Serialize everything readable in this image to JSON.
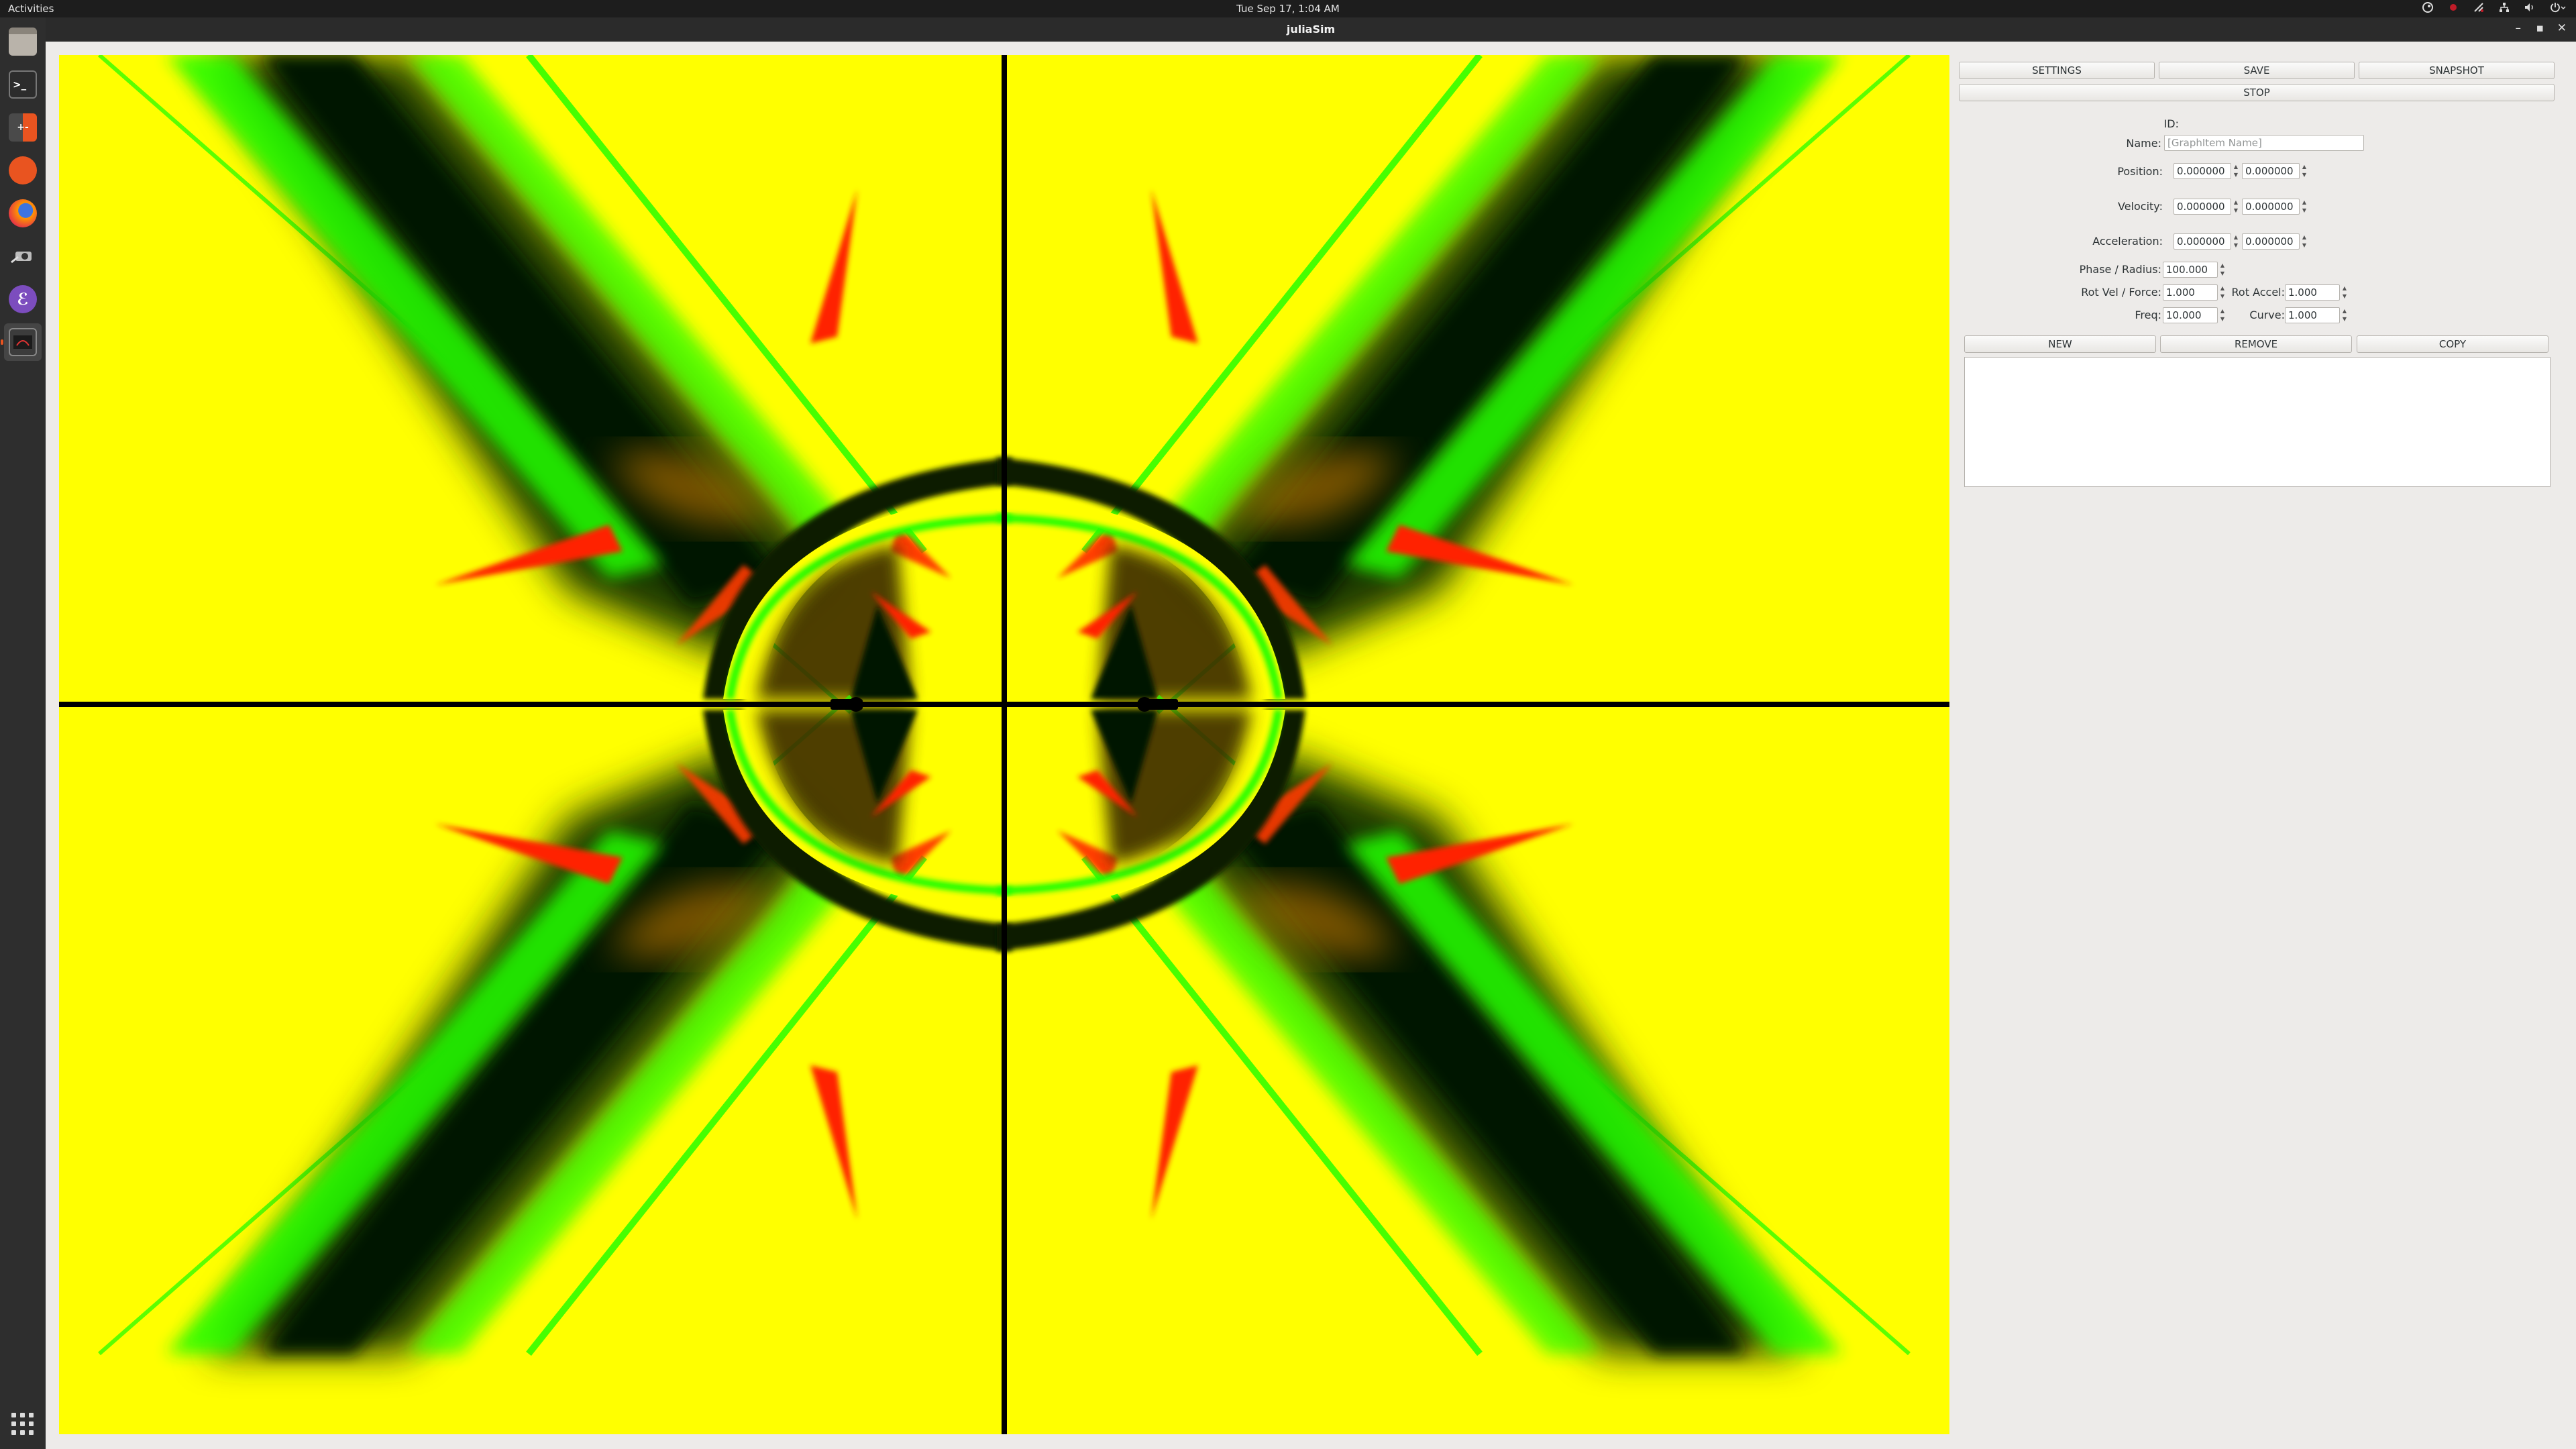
{
  "topbar": {
    "activities": "Activities",
    "clock": "Tue Sep 17,  1:04 AM",
    "tray": [
      "steam-icon",
      "record-icon",
      "antenna-icon",
      "network-icon",
      "volume-icon",
      "power-icon"
    ]
  },
  "dock": {
    "items": [
      "files-icon",
      "terminal-icon",
      "calculator-icon",
      "ubuntu-software-icon",
      "firefox-icon",
      "screenshot-tool-icon",
      "emacs-icon",
      "juliasim-app-icon"
    ]
  },
  "window": {
    "title": "juliaSim",
    "minimize": "–",
    "maximize": "▪",
    "close": "✕"
  },
  "colors": {
    "background_field": "#ffff00",
    "green": "#00ff00",
    "red": "#ff2000",
    "dark": "#061800",
    "axes": "#000000"
  },
  "panel": {
    "settings": "SETTINGS",
    "save": "SAVE",
    "snapshot": "SNAPSHOT",
    "stop": "STOP",
    "id_label": "ID:",
    "name_label": "Name:",
    "name_placeholder": "[GraphItem Name]",
    "position_label": "Position:",
    "position_x": "0.000000",
    "position_y": "0.000000",
    "velocity_label": "Velocity:",
    "velocity_x": "0.000000",
    "velocity_y": "0.000000",
    "acceleration_label": "Acceleration:",
    "acceleration_x": "0.000000",
    "acceleration_y": "0.000000",
    "phase_radius_label": "Phase / Radius:",
    "phase_radius": "100.000",
    "rot_vel_force_label": "Rot Vel / Force:",
    "rot_vel_force": "1.000",
    "rot_accel_label": "Rot Accel:",
    "rot_accel": "1.000",
    "freq_label": "Freq:",
    "freq": "10.000",
    "curve_label": "Curve:",
    "curve": "1.000",
    "new": "NEW",
    "remove": "REMOVE",
    "copy": "COPY"
  }
}
